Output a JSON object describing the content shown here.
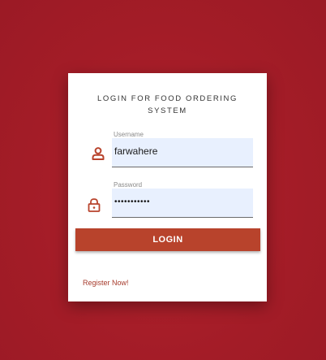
{
  "form": {
    "title": "LOGIN FOR FOOD ORDERING SYSTEM",
    "username": {
      "label": "Username",
      "value": "farwahere",
      "icon": "user-icon"
    },
    "password": {
      "label": "Password",
      "value": "•••••••••••",
      "icon": "lock-icon"
    },
    "login_label": "LOGIN",
    "register_label": "Register Now!"
  },
  "colors": {
    "background": "#a81e2a",
    "card": "#ffffff",
    "accent": "#b8432c",
    "icon": "#b8432c",
    "input_fill": "#e8f0fe"
  }
}
